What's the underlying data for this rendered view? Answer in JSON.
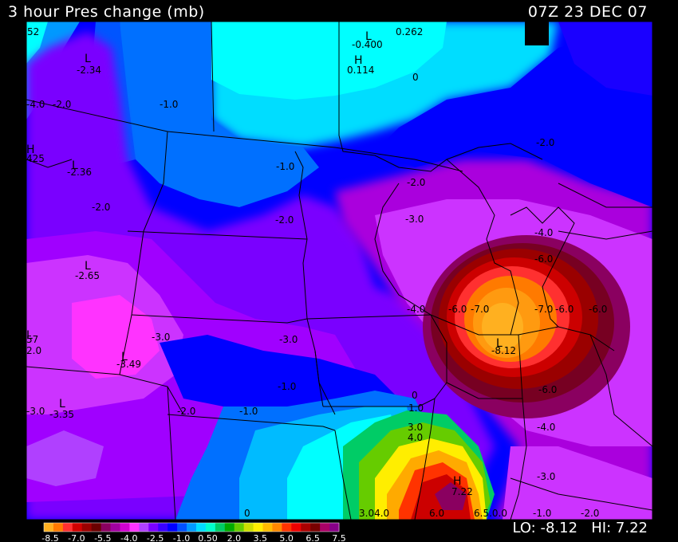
{
  "header": {
    "title": "3 hour Pres change (mb)",
    "valid_time": "07Z 23 DEC 07"
  },
  "footer": {
    "lo_label": "LO:",
    "lo_value": "-8.12",
    "hi_label": "HI:",
    "hi_value": "7.22"
  },
  "colorbar": {
    "colors": [
      "#ffb020",
      "#ff7a00",
      "#ff3030",
      "#d00000",
      "#9a0000",
      "#6a0000",
      "#8a0060",
      "#a000a0",
      "#d000d0",
      "#ff33ff",
      "#b040ff",
      "#7a00ff",
      "#3a00ff",
      "#0000ff",
      "#0050ff",
      "#0099ff",
      "#00ddff",
      "#00ffcc",
      "#00cc66",
      "#00aa00",
      "#66cc00",
      "#ccdd00",
      "#ffee00",
      "#ffbb00",
      "#ff8800",
      "#ff3300",
      "#ee0000",
      "#aa0000",
      "#770000",
      "#aa0066",
      "#880088"
    ],
    "tick_labels": [
      "-8.5",
      "-7.0",
      "-5.5",
      "-4.0",
      "-2.5",
      "-1.0",
      "0.50",
      "2.0",
      "3.5",
      "5.0",
      "6.5",
      "7.5"
    ]
  },
  "map_labels": [
    {
      "text": "52",
      "k": "a1"
    },
    {
      "text": "-0.400",
      "k": "a2"
    },
    {
      "text": "0.262",
      "k": "a3"
    },
    {
      "text": "-2.34",
      "k": "a4"
    },
    {
      "text": "0.114",
      "k": "a5"
    },
    {
      "text": "0",
      "k": "a6"
    },
    {
      "text": "-4.0",
      "k": "a7"
    },
    {
      "text": "-2.0",
      "k": "a8"
    },
    {
      "text": "-1.0",
      "k": "a9"
    },
    {
      "text": "425",
      "k": "a10"
    },
    {
      "text": "-2.36",
      "k": "a11"
    },
    {
      "text": "-1.0",
      "k": "a12"
    },
    {
      "text": "-2.0",
      "k": "a13"
    },
    {
      "text": "-2.0",
      "k": "a14"
    },
    {
      "text": "-3.0",
      "k": "a15"
    },
    {
      "text": "-2.0",
      "k": "a16"
    },
    {
      "text": "-2.0",
      "k": "a17"
    },
    {
      "text": "-2.65",
      "k": "a18"
    },
    {
      "text": "-4.0",
      "k": "a19"
    },
    {
      "text": "-6.0",
      "k": "a20"
    },
    {
      "text": "-4.0",
      "k": "a21"
    },
    {
      "text": "-6.0",
      "k": "a22"
    },
    {
      "text": "-7.0",
      "k": "a23"
    },
    {
      "text": "-7.0",
      "k": "a24"
    },
    {
      "text": "-6.0",
      "k": "a25"
    },
    {
      "text": "-6.0",
      "k": "a26"
    },
    {
      "text": "57",
      "k": "a27"
    },
    {
      "text": "-3.0",
      "k": "a28"
    },
    {
      "text": "-3.0",
      "k": "a29"
    },
    {
      "text": "2.0",
      "k": "a30"
    },
    {
      "text": "-8.12",
      "k": "a31"
    },
    {
      "text": "-3.49",
      "k": "a32"
    },
    {
      "text": "-1.0",
      "k": "a33"
    },
    {
      "text": "-6.0",
      "k": "a34"
    },
    {
      "text": "0",
      "k": "a35"
    },
    {
      "text": "-3.0",
      "k": "a36"
    },
    {
      "text": "-3.35",
      "k": "a37"
    },
    {
      "text": "-2.0",
      "k": "a38"
    },
    {
      "text": "-1.0",
      "k": "a39"
    },
    {
      "text": "1.0",
      "k": "a40"
    },
    {
      "text": "3.0",
      "k": "a41"
    },
    {
      "text": "4.0",
      "k": "a42"
    },
    {
      "text": "-4.0",
      "k": "a43"
    },
    {
      "text": "7.22",
      "k": "a44"
    },
    {
      "text": "-3.0",
      "k": "a45"
    },
    {
      "text": "0",
      "k": "a46"
    },
    {
      "text": "3.04.0",
      "k": "a47"
    },
    {
      "text": "6.0",
      "k": "a48"
    },
    {
      "text": "6.5.0.0",
      "k": "a49"
    },
    {
      "text": "-1.0",
      "k": "a50"
    },
    {
      "text": "-2.0",
      "k": "a51"
    }
  ],
  "extrema": [
    {
      "text": "L",
      "k": "e1"
    },
    {
      "text": "H",
      "k": "e2"
    },
    {
      "text": "L",
      "k": "e3"
    },
    {
      "text": "H",
      "k": "e4"
    },
    {
      "text": "L",
      "k": "e5"
    },
    {
      "text": "L",
      "k": "e6"
    },
    {
      "text": "L",
      "k": "e7"
    },
    {
      "text": "L",
      "k": "e8"
    },
    {
      "text": "L",
      "k": "e9"
    },
    {
      "text": "L",
      "k": "e10"
    },
    {
      "text": "H",
      "k": "e11"
    }
  ]
}
